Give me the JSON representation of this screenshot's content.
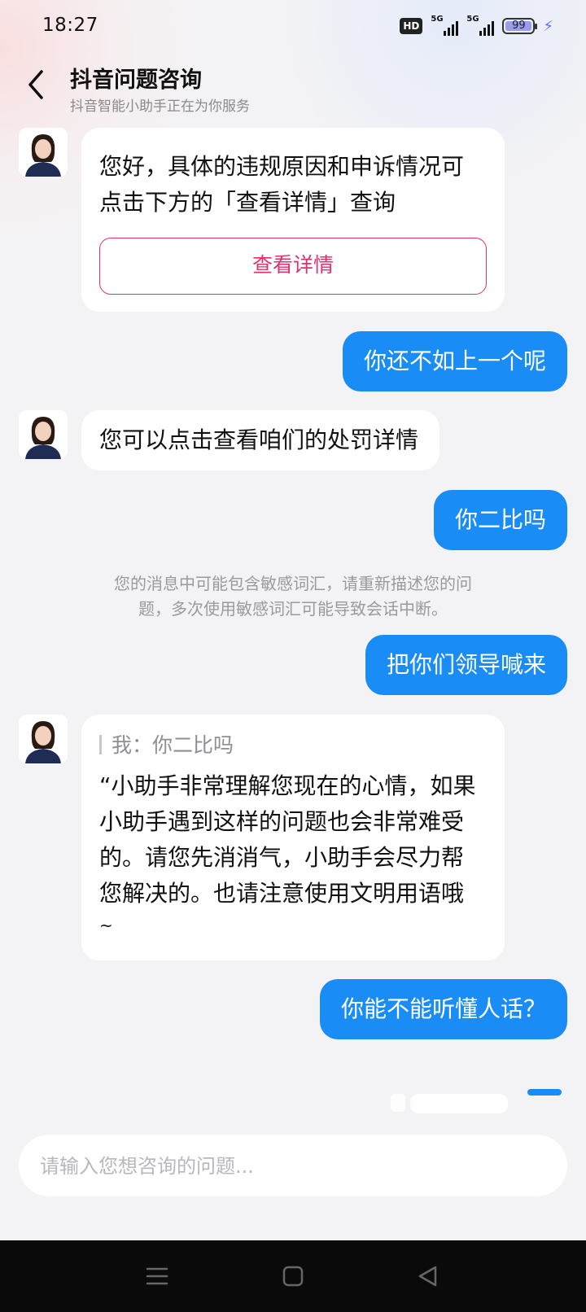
{
  "status_bar": {
    "time": "18:27",
    "hd_label": "HD",
    "signal_1_label": "5G",
    "signal_2_label": "5G",
    "battery_level": "99"
  },
  "header": {
    "title": "抖音问题咨询",
    "subtitle": "抖音智能小助手正在为你服务"
  },
  "messages": [
    {
      "from": "assistant",
      "lines": [
        "您好，具体的违规原因和申诉情况可",
        "点击下方的「查看详情」查询"
      ],
      "button_label": "查看详情"
    },
    {
      "from": "user",
      "text": "你还不如上一个呢"
    },
    {
      "from": "assistant",
      "lines": [
        "您可以点击查看咱们的处罚详情"
      ]
    },
    {
      "from": "user",
      "text": "你二比吗"
    },
    {
      "from": "system",
      "lines": [
        "您的消息中可能包含敏感词汇，请重新描述您的问",
        "题，多次使用敏感词汇可能导致会话中断。"
      ]
    },
    {
      "from": "user",
      "text": "把你们领导喊来"
    },
    {
      "from": "assistant",
      "quote": "我：你二比吗",
      "lines": [
        "“小助手非常理解您现在的心情，如果",
        "小助手遇到这样的问题也会非常难受",
        "的。请您先消消气，小助手会尽力帮",
        "您解决的。也请注意使用文明用语哦",
        "~"
      ]
    },
    {
      "from": "user",
      "text": "你能不能听懂人话？"
    }
  ],
  "input": {
    "placeholder": "请输入您想咨询的问题..."
  },
  "colors": {
    "user_bubble": "#1a8cf5",
    "accent_button": "#e0306f",
    "background": "#f3f3f5"
  }
}
